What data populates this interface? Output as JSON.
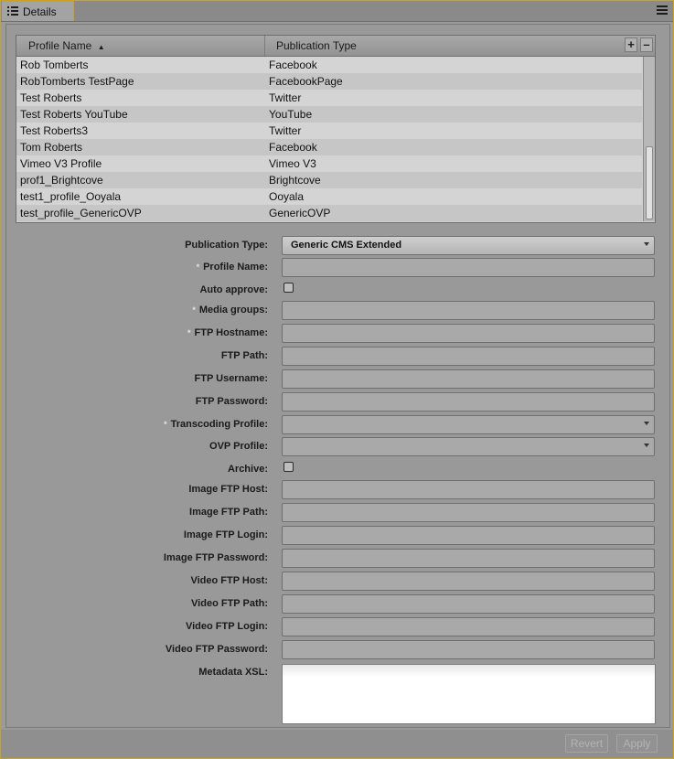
{
  "tab": {
    "label": "Details",
    "icon": "list-icon"
  },
  "window": {
    "menu_icon": "hamburger-icon"
  },
  "table": {
    "headers": {
      "profile_name": "Profile Name",
      "sort_indicator": "▲",
      "publication_type": "Publication Type"
    },
    "add_label": "+",
    "remove_label": "–",
    "rows": [
      {
        "name": "Rob Tomberts",
        "type": "Facebook"
      },
      {
        "name": "RobTomberts TestPage",
        "type": "FacebookPage"
      },
      {
        "name": "Test Roberts",
        "type": "Twitter"
      },
      {
        "name": "Test Roberts YouTube",
        "type": "YouTube"
      },
      {
        "name": "Test Roberts3",
        "type": "Twitter"
      },
      {
        "name": "Tom Roberts",
        "type": "Facebook"
      },
      {
        "name": "Vimeo V3 Profile",
        "type": "Vimeo V3"
      },
      {
        "name": "prof1_Brightcove",
        "type": "Brightcove"
      },
      {
        "name": "test1_profile_Ooyala",
        "type": "Ooyala"
      },
      {
        "name": "test_profile_GenericOVP",
        "type": "GenericOVP"
      }
    ]
  },
  "form": {
    "publication_type": {
      "label": "Publication Type:",
      "value": "Generic CMS Extended"
    },
    "profile_name": {
      "label": "Profile Name:",
      "value": ""
    },
    "auto_approve": {
      "label": "Auto approve:",
      "checked": false
    },
    "media_groups": {
      "label": "Media groups:",
      "value": ""
    },
    "ftp_hostname": {
      "label": "FTP Hostname:",
      "value": ""
    },
    "ftp_path": {
      "label": "FTP Path:",
      "value": ""
    },
    "ftp_username": {
      "label": "FTP Username:",
      "value": ""
    },
    "ftp_password": {
      "label": "FTP Password:",
      "value": ""
    },
    "transcoding_profile": {
      "label": "Transcoding Profile:",
      "value": ""
    },
    "ovp_profile": {
      "label": "OVP Profile:",
      "value": ""
    },
    "archive": {
      "label": "Archive:",
      "checked": false
    },
    "image_ftp_host": {
      "label": "Image FTP Host:",
      "value": ""
    },
    "image_ftp_path": {
      "label": "Image FTP Path:",
      "value": ""
    },
    "image_ftp_login": {
      "label": "Image FTP Login:",
      "value": ""
    },
    "image_ftp_password": {
      "label": "Image FTP Password:",
      "value": ""
    },
    "video_ftp_host": {
      "label": "Video FTP Host:",
      "value": ""
    },
    "video_ftp_path": {
      "label": "Video FTP Path:",
      "value": ""
    },
    "video_ftp_login": {
      "label": "Video FTP Login:",
      "value": ""
    },
    "video_ftp_password": {
      "label": "Video FTP Password:",
      "value": ""
    },
    "metadata_xsl": {
      "label": "Metadata XSL:",
      "value": ""
    },
    "required_marker": "*"
  },
  "buttons": {
    "revert": "Revert",
    "apply": "Apply"
  }
}
